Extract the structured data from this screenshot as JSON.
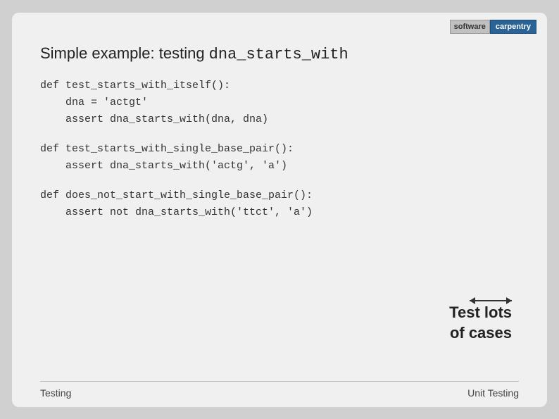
{
  "logo": {
    "software_label": "software",
    "carpentry_label": "carpentry"
  },
  "slide": {
    "title_prefix": "Simple example: testing ",
    "title_code": "dna_starts_with",
    "code_sections": [
      {
        "lines": [
          "def test_starts_with_itself():",
          "    dna = 'actgt'",
          "    assert dna_starts_with(dna, dna)"
        ]
      },
      {
        "lines": [
          "def test_starts_with_single_base_pair():",
          "    assert dna_starts_with('actg', 'a')"
        ]
      },
      {
        "lines": [
          "def does_not_start_with_single_base_pair():",
          "    assert not dna_starts_with('ttct', 'a')"
        ]
      }
    ],
    "annotation_line1": "Test lots",
    "annotation_line2": "of cases",
    "footer_left": "Testing",
    "footer_right": "Unit Testing"
  }
}
